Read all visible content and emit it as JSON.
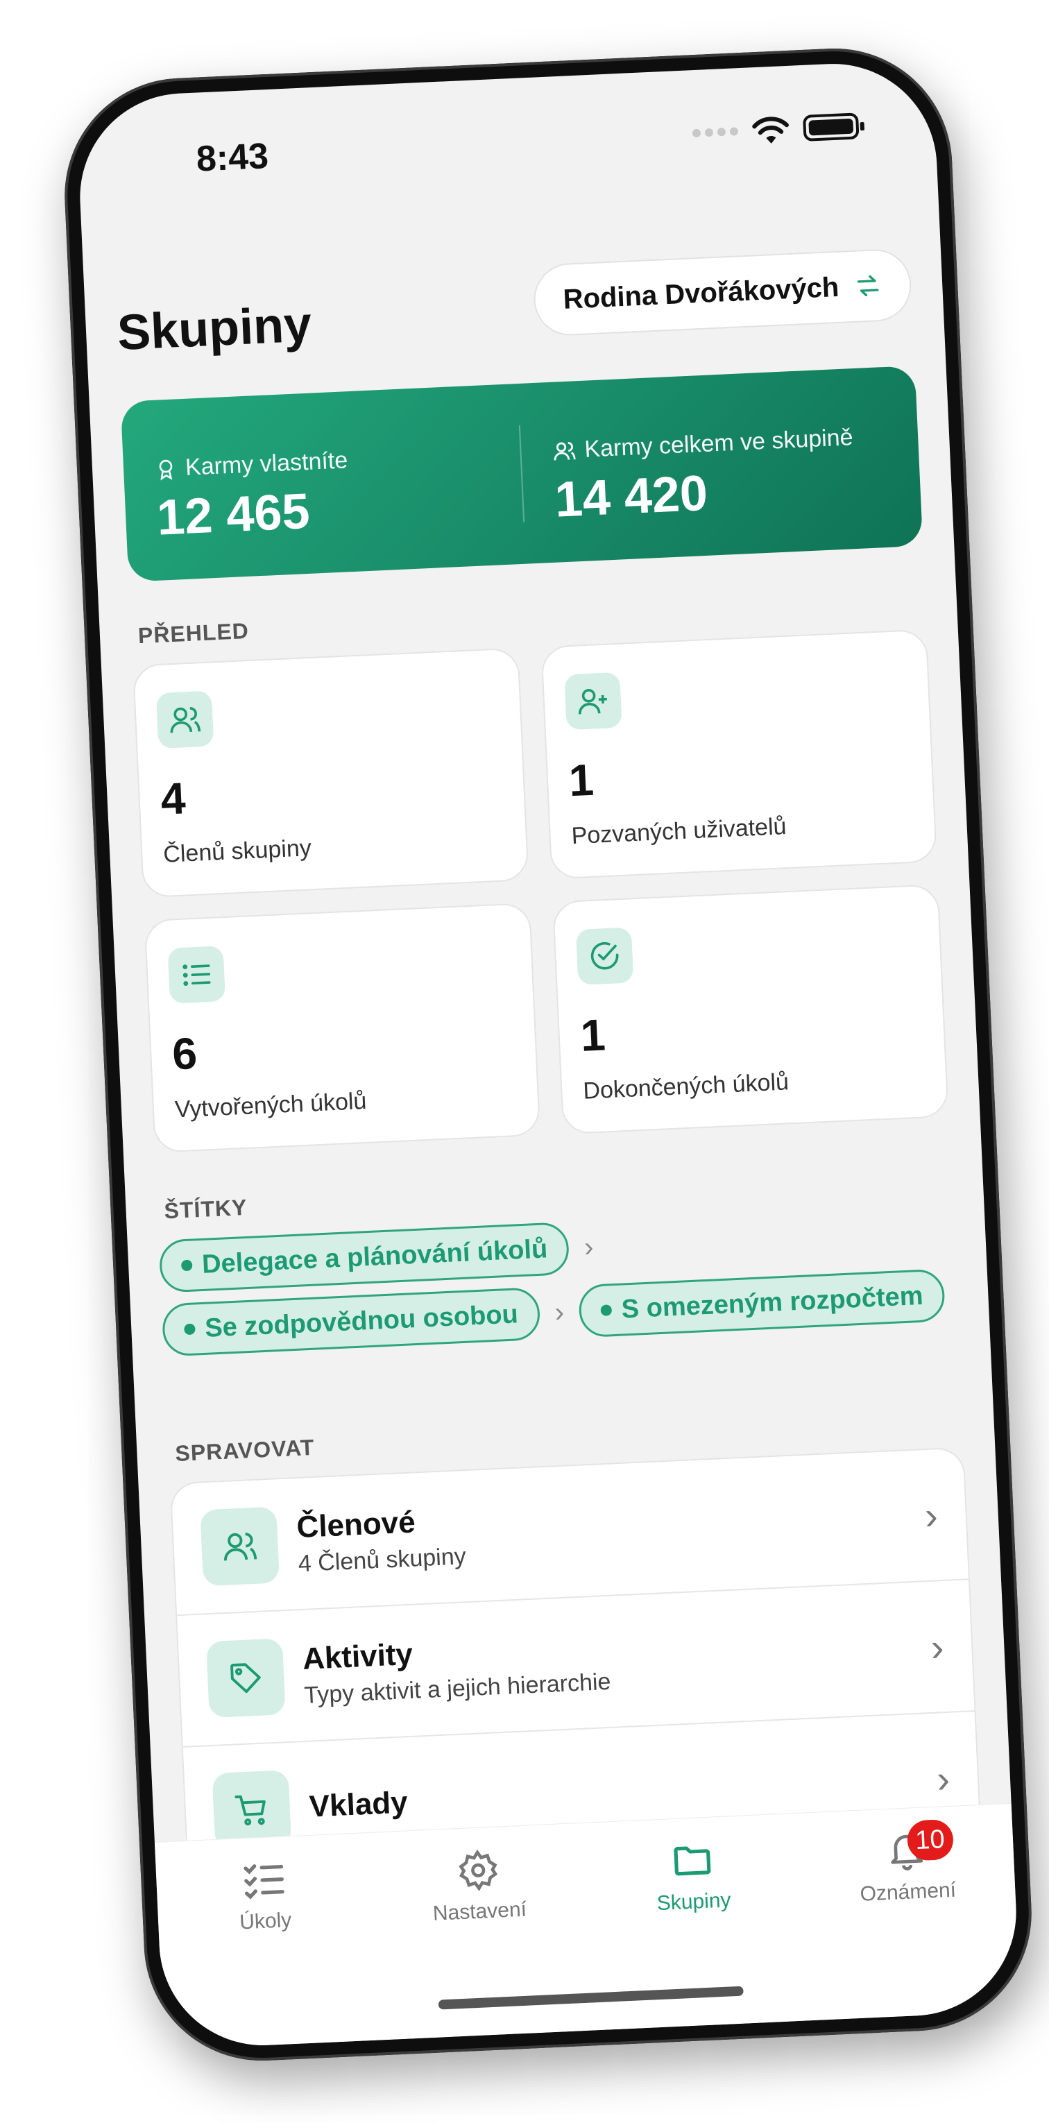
{
  "status_bar": {
    "time": "8:43"
  },
  "header": {
    "title": "Skupiny",
    "group_name": "Rodina Dvořákových"
  },
  "karma": {
    "owned_label": "Karmy vlastníte",
    "owned_value": "12 465",
    "total_label": "Karmy celkem ve skupině",
    "total_value": "14 420"
  },
  "overview": {
    "section_title": "PŘEHLED",
    "stats": [
      {
        "value": "4",
        "label": "Členů skupiny",
        "icon": "users-icon"
      },
      {
        "value": "1",
        "label": "Pozvaných uživatelů",
        "icon": "user-plus-icon"
      },
      {
        "value": "6",
        "label": "Vytvořených úkolů",
        "icon": "list-icon"
      },
      {
        "value": "1",
        "label": "Dokončených úkolů",
        "icon": "check-circle-icon"
      }
    ]
  },
  "tags": {
    "section_title": "ŠTÍTKY",
    "items": [
      "Delegace a plánování úkolů",
      "Se zodpovědnou osobou",
      "S omezeným rozpočtem"
    ]
  },
  "manage": {
    "section_title": "SPRAVOVAT",
    "items": [
      {
        "title": "Členové",
        "subtitle": "4 Členů skupiny",
        "icon": "users-icon"
      },
      {
        "title": "Aktivity",
        "subtitle": "Typy aktivit a jejich hierarchie",
        "icon": "tag-icon"
      },
      {
        "title": "Vklady",
        "subtitle": "",
        "icon": "cart-icon"
      }
    ]
  },
  "tab_bar": {
    "items": [
      {
        "label": "Úkoly",
        "icon": "tasks-icon"
      },
      {
        "label": "Nastavení",
        "icon": "gear-icon"
      },
      {
        "label": "Skupiny",
        "icon": "folder-icon"
      },
      {
        "label": "Oznámení",
        "icon": "bell-icon",
        "badge": "10"
      }
    ]
  },
  "colors": {
    "accent": "#1c9a72",
    "accent_light": "#d6efe6",
    "badge": "#e31b1b"
  }
}
